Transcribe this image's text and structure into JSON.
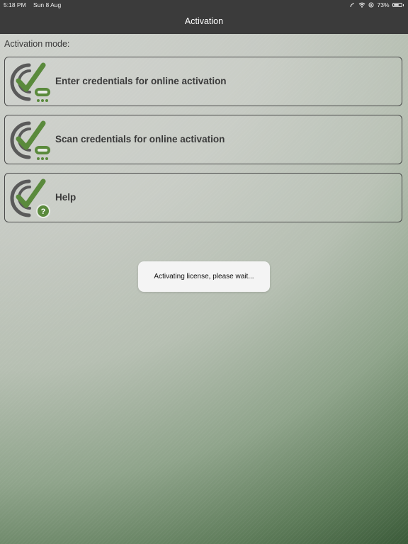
{
  "status_bar": {
    "time": "5:18 PM",
    "date": "Sun 8 Aug",
    "battery_percent": "73%",
    "battery_level": 0.73,
    "icons": [
      "signal-icon",
      "wifi-icon",
      "orientation-lock-icon",
      "battery-icon"
    ]
  },
  "nav": {
    "title": "Activation"
  },
  "section": {
    "label": "Activation mode:"
  },
  "options": [
    {
      "label": "Enter credentials for online activation",
      "icon": "checkmark-key-icon"
    },
    {
      "label": "Scan credentials for online activation",
      "icon": "checkmark-key-icon"
    },
    {
      "label": "Help",
      "icon": "checkmark-help-icon"
    }
  ],
  "toast": {
    "message": "Activating license, please wait..."
  },
  "colors": {
    "nav_background": "#3b3b3b",
    "accent_green": "#5a8a3c",
    "icon_gray": "#5a5a5a",
    "text_dark": "#3a3a3a"
  }
}
